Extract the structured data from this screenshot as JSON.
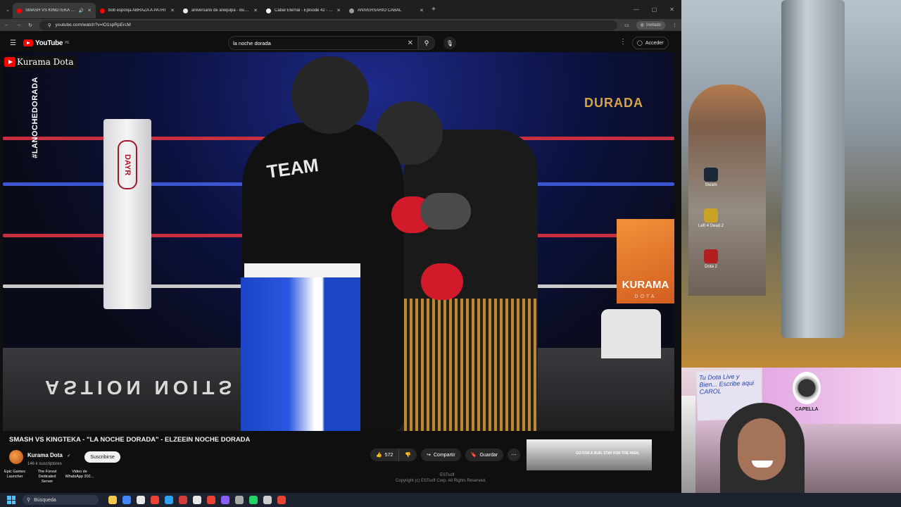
{
  "browser": {
    "tabs": [
      {
        "title": "SMASH VS KINGTEKA - \"LA",
        "favicon_color": "#ff0000",
        "active": true
      },
      {
        "title": "bob esponja ABRAZA A PATRI",
        "favicon_color": "#ff0000",
        "active": false
      },
      {
        "title": "aniversario de arequipa - Busca",
        "favicon_color": "#e8e8e8",
        "active": false
      },
      {
        "title": "Cabal Eternal - Episode 42 - Fu",
        "favicon_color": "#ffffff",
        "active": false
      },
      {
        "title": "ANIVERSARIO CABAL",
        "favicon_color": "#9c9c9c",
        "active": false
      }
    ],
    "url": "youtube.com/watch?v=lO1spRpErcM",
    "incognito_label": "Invitado"
  },
  "youtube": {
    "logo_text": "YouTube",
    "region": "PE",
    "search_value": "la noche dorada",
    "signin_label": "Acceder"
  },
  "video": {
    "channel_watermark": "Kurama Dota",
    "hashtag": "#LANOCHEDORADA",
    "sponsor": "DURADA",
    "post_logo": "DAYR",
    "shirt_text": "TEAM",
    "mat_text": "ASTION NOITS",
    "corner_logo": "KURAMA",
    "corner_logo_sub": "DOTA",
    "title": "SMASH VS KINGTEKA - \"LA NOCHE DORADA\" - ELZEEIN NOCHE DORADA",
    "channel_name": "Kurama Dota",
    "subscribers": "146 k suscriptores",
    "subscribe_label": "Suscribirse",
    "likes": "572",
    "share_label": "Compartir",
    "save_label": "Guardar",
    "ad_text": "GO FOR A RUN. STAY FOR THE HIGH."
  },
  "desktop": {
    "icons": [
      {
        "label": "Steam",
        "color": "#1b2838"
      },
      {
        "label": "Left 4 Dead 2",
        "color": "#c9a227"
      },
      {
        "label": "Dota 2",
        "color": "#b21f1f"
      }
    ],
    "bottom_icons": [
      "Epic Games Launcher",
      "The Forest Dedicated Server",
      "Video de WhatsApp 202..."
    ],
    "copyright": "Copyright (c) ESTsoft Corp. All Rights Reserved.",
    "footer_tag": "ESTsoft"
  },
  "webcam": {
    "note_text": "Tu Dota Live y Bien... Escribe aqui CAROL",
    "banner": "CAPELLA"
  },
  "taskbar": {
    "search_placeholder": "Búsqueda",
    "apps": [
      "#f2c94c",
      "#4285f4",
      "#e8e8e8",
      "#ea4335",
      "#2ea3f2",
      "#d63a3a",
      "#e8e8e8",
      "#ea4335",
      "#8b5cf6",
      "#aaaaaa",
      "#25d366",
      "#cccccc",
      "#ea4335"
    ]
  }
}
